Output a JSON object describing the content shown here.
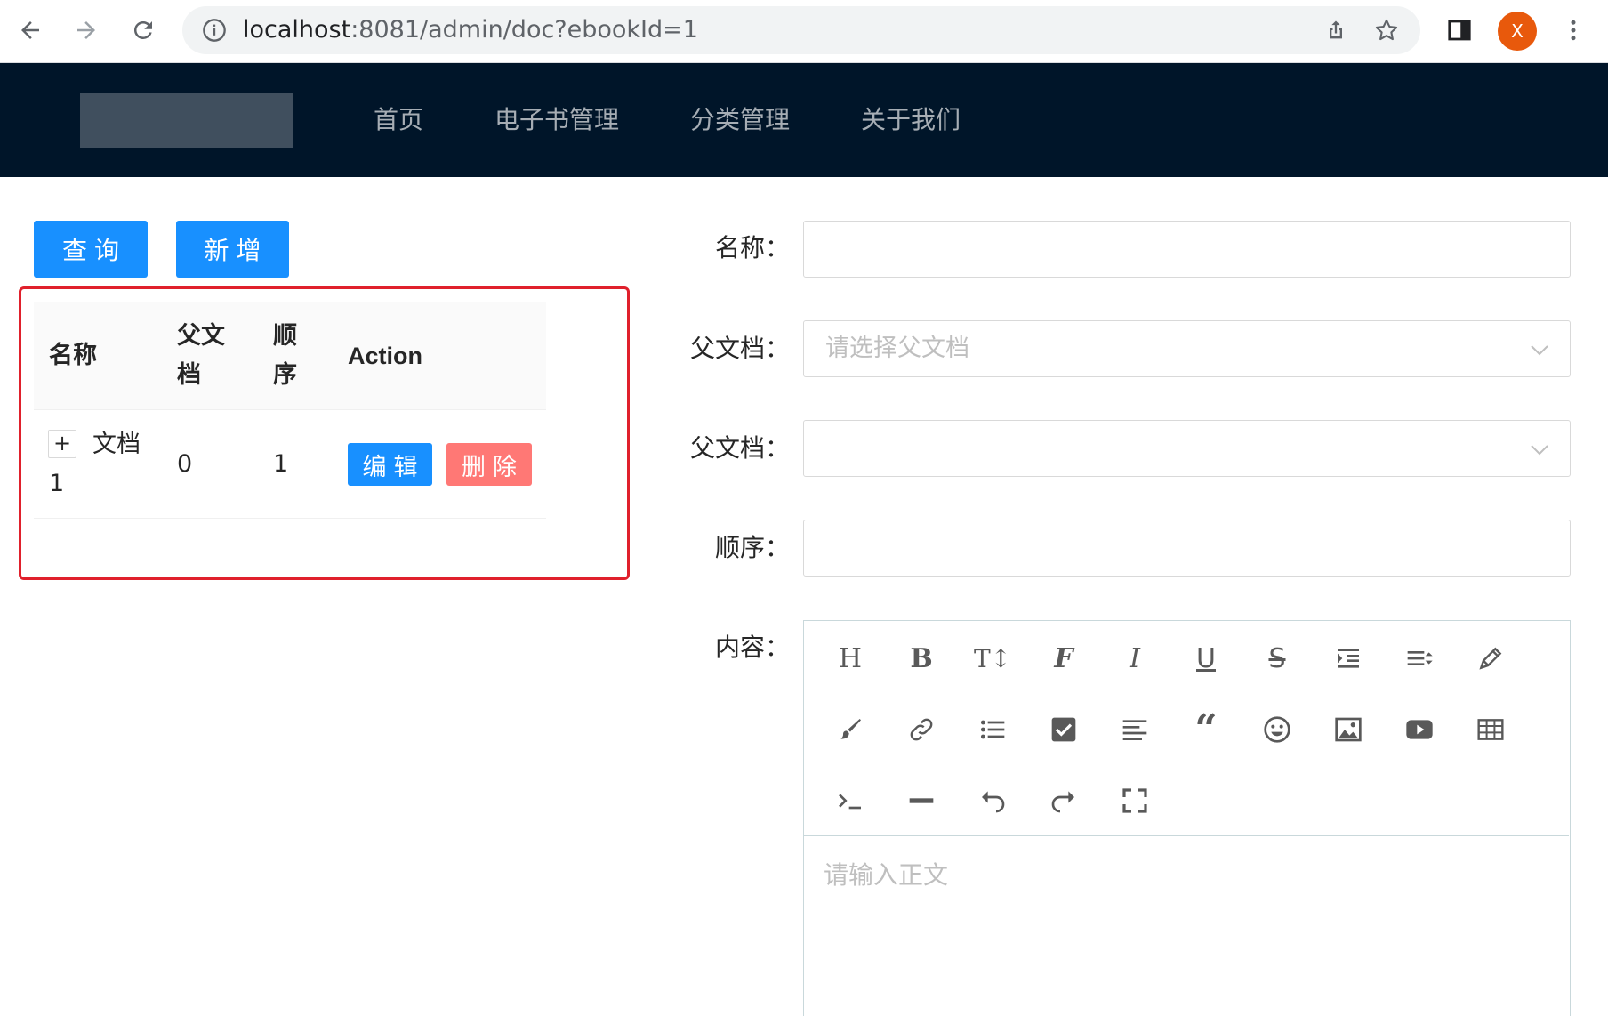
{
  "browser": {
    "url_host": "localhost",
    "url_path": ":8081/admin/doc?ebookId=1",
    "profile_initial": "X"
  },
  "header": {
    "menu": [
      "首页",
      "电子书管理",
      "分类管理",
      "关于我们"
    ]
  },
  "actions": {
    "query_label": "查询",
    "add_label": "新增"
  },
  "table": {
    "columns": {
      "name": "名称",
      "parent_line1": "父文",
      "parent_line2": "档",
      "sort_line1": "顺",
      "sort_line2": "序",
      "action": "Action"
    },
    "rows": [
      {
        "expand": "+",
        "name_line1": "文档",
        "name_line2": "1",
        "parent": "0",
        "sort": "1",
        "edit_label": "编辑",
        "delete_label": "删除"
      }
    ]
  },
  "form": {
    "name_label": "名称：",
    "parent_label": "父文档：",
    "parent_placeholder": "请选择父文档",
    "parent2_label": "父文档：",
    "sort_label": "顺序：",
    "content_label": "内容：",
    "content_placeholder": "请输入正文"
  },
  "editor_toolbar": [
    "heading-icon",
    "bold-icon",
    "font-size-icon",
    "font-family-icon",
    "italic-icon",
    "underline-icon",
    "strikethrough-icon",
    "indent-icon",
    "line-height-icon",
    "foreground-color-icon",
    "background-color-icon",
    "link-icon",
    "bulleted-list-icon",
    "todo-icon",
    "justify-icon",
    "quote-icon",
    "emoticon-icon",
    "image-icon",
    "video-icon",
    "table-icon",
    "code-icon",
    "divider-icon",
    "undo-icon",
    "redo-icon",
    "fullscreen-icon"
  ],
  "colors": {
    "header_bg": "#001529",
    "primary": "#1890ff",
    "danger": "#ff7875",
    "highlight": "#e0202c"
  }
}
